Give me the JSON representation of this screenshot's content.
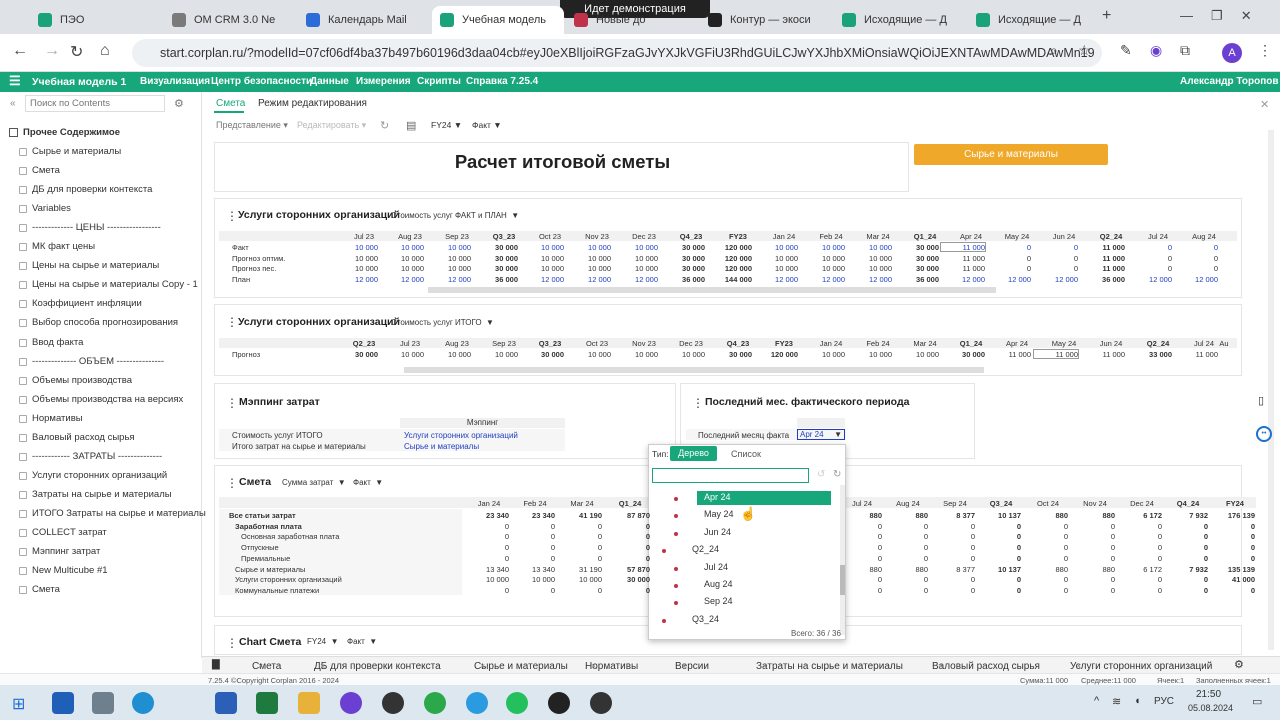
{
  "browser": {
    "tabs": [
      {
        "label": "ПЭО",
        "color": "#1aa37a"
      },
      {
        "label": "OM CRM 3.0 Ne",
        "color": "#7a7a7a"
      },
      {
        "label": "Календарь Mail",
        "color": "#2b6cd8"
      },
      {
        "label": "Учебная модель",
        "color": "#1aa37a"
      },
      {
        "label": "Новые до",
        "color": "#c0324a"
      },
      {
        "label": "Контур — экоси",
        "color": "#222222"
      },
      {
        "label": "Исходящие — Д",
        "color": "#1aa37a"
      },
      {
        "label": "Исходящие — Д",
        "color": "#1aa37a"
      }
    ],
    "demo_banner": "Идет демонстрация",
    "url": "start.corplan.ru/?modelId=07cf06df4ba37b497b60196d3daa04cb#eyJ0eXBlIjoiRGFzaGJvYXJkVGFiU3RhdGUiLCJwYXJhbXMiOnsiaWQiOiJEXNTAwMDAwMDAwMn19",
    "profile_initial": "A"
  },
  "app": {
    "title": "Учебная модель 1",
    "menu": [
      "Визуализация",
      "Центр безопасности",
      "Данные",
      "Измерения",
      "Скрипты",
      "Справка 7.25.4"
    ],
    "user": "Александр Торопов"
  },
  "sidebar": {
    "search_placeholder": "Поиск по Contents",
    "root": "Прочее Содержимое",
    "items": [
      "Сырье и материалы",
      "Смета",
      "ДБ для проверки контекста",
      "Variables",
      "------------- ЦЕНЫ -----------------",
      "МК факт цены",
      "Цены на сырье и материалы",
      "Цены на сырье и материалы Copy - 1",
      "Коэффициент инфляции",
      "Выбор способа прогнозирования",
      "Ввод факта",
      "-------------- ОБЪЕМ ---------------",
      "Объемы производства",
      "Объемы производства на версиях",
      "Нормативы",
      "Валовый расход сырья",
      "------------ ЗАТРАТЫ --------------",
      "Услуги сторонних организаций",
      "Затраты на сырье и материалы",
      "ИТОГО Затраты на сырье и материалы",
      "COLLECT затрат",
      "Мэппинг затрат",
      "New Multicube #1",
      "Смета"
    ]
  },
  "subtabs": [
    "Смета",
    "Режим редактирования"
  ],
  "toolbar": {
    "view": "Представление",
    "edit": "Редактировать",
    "period": "FY24",
    "version": "Факт"
  },
  "header": {
    "title": "Расчет итоговой сметы",
    "button": "Сырье и материалы"
  },
  "block1": {
    "title": "Услуги сторонних организаций",
    "selector": "Стоимость услуг ФАКТ и ПЛАН",
    "columns": [
      "Jul 23",
      "Aug 23",
      "Sep 23",
      "Q3_23",
      "Oct 23",
      "Nov 23",
      "Dec 23",
      "Q4_23",
      "FY23",
      "Jan 24",
      "Feb 24",
      "Mar 24",
      "Q1_24",
      "Apr 24",
      "May 24",
      "Jun 24",
      "Q2_24",
      "Jul 24",
      "Aug 24"
    ],
    "rows": [
      {
        "label": "Факт",
        "values": [
          "10 000",
          "10 000",
          "10 000",
          "30 000",
          "10 000",
          "10 000",
          "10 000",
          "30 000",
          "120 000",
          "10 000",
          "10 000",
          "10 000",
          "30 000",
          "11 000",
          "0",
          "0",
          "11 000",
          "0",
          "0"
        ]
      },
      {
        "label": "Прогноз оптим.",
        "values": [
          "10 000",
          "10 000",
          "10 000",
          "30 000",
          "10 000",
          "10 000",
          "10 000",
          "30 000",
          "120 000",
          "10 000",
          "10 000",
          "10 000",
          "30 000",
          "11 000",
          "0",
          "0",
          "11 000",
          "0",
          "0"
        ]
      },
      {
        "label": "Прогноз пес.",
        "values": [
          "10 000",
          "10 000",
          "10 000",
          "30 000",
          "10 000",
          "10 000",
          "10 000",
          "30 000",
          "120 000",
          "10 000",
          "10 000",
          "10 000",
          "30 000",
          "11 000",
          "0",
          "0",
          "11 000",
          "0",
          "0"
        ]
      },
      {
        "label": "План",
        "values": [
          "12 000",
          "12 000",
          "12 000",
          "36 000",
          "12 000",
          "12 000",
          "12 000",
          "36 000",
          "144 000",
          "12 000",
          "12 000",
          "12 000",
          "36 000",
          "12 000",
          "12 000",
          "12 000",
          "36 000",
          "12 000",
          "12 000"
        ]
      }
    ]
  },
  "block2": {
    "title": "Услуги сторонних организаций",
    "selector": "Стоимость услуг ИТОГО",
    "columns": [
      "Q2_23",
      "Jul 23",
      "Aug 23",
      "Sep 23",
      "Q3_23",
      "Oct 23",
      "Nov 23",
      "Dec 23",
      "Q4_23",
      "FY23",
      "Jan 24",
      "Feb 24",
      "Mar 24",
      "Q1_24",
      "Apr 24",
      "May 24",
      "Jun 24",
      "Q2_24",
      "Jul 24",
      "Au"
    ],
    "rows": [
      {
        "label": "Прогноз",
        "values": [
          "30 000",
          "10 000",
          "10 000",
          "10 000",
          "30 000",
          "10 000",
          "10 000",
          "10 000",
          "30 000",
          "120 000",
          "10 000",
          "10 000",
          "10 000",
          "30 000",
          "11 000",
          "11 000",
          "11 000",
          "33 000",
          "11 000",
          ""
        ]
      }
    ]
  },
  "block3": {
    "title": "Мэппинг затрат",
    "col_header": "Мэппинг",
    "rows": [
      {
        "label": "Стоимость услуг ИТОГО",
        "value": "Услуги сторонних организаций"
      },
      {
        "label": "Итого затрат на сырье и материалы",
        "value": "Сырье и материалы"
      }
    ]
  },
  "block4": {
    "title": "Последний мес. фактического периода",
    "label": "Последний месяц факта",
    "value": "Apr 24"
  },
  "block5": {
    "title": "Смета",
    "selector1": "Сумма затрат",
    "selector2": "Факт",
    "cols_left": [
      "Jan 24",
      "Feb 24",
      "Mar 24",
      "Q1_24"
    ],
    "cols_right": [
      "Jul 24",
      "Aug 24",
      "Sep 24",
      "Q3_24",
      "Oct 24",
      "Nov 24",
      "Dec 24",
      "Q4_24",
      "FY24"
    ],
    "rows": [
      {
        "label": "Все статьи затрат",
        "indent": 0,
        "bold": true,
        "left": [
          "23 340",
          "23 340",
          "41 190",
          "87 870"
        ],
        "right": [
          "880",
          "880",
          "8 377",
          "10 137",
          "880",
          "880",
          "6 172",
          "7 932",
          "176 139"
        ]
      },
      {
        "label": "Заработная плата",
        "indent": 1,
        "bold": true,
        "left": [
          "0",
          "0",
          "0",
          "0"
        ],
        "right": [
          "0",
          "0",
          "0",
          "0",
          "0",
          "0",
          "0",
          "0",
          "0"
        ]
      },
      {
        "label": "Основная заработная плата",
        "indent": 2,
        "bold": false,
        "left": [
          "0",
          "0",
          "0",
          "0"
        ],
        "right": [
          "0",
          "0",
          "0",
          "0",
          "0",
          "0",
          "0",
          "0",
          "0"
        ]
      },
      {
        "label": "Отпускные",
        "indent": 2,
        "bold": false,
        "left": [
          "0",
          "0",
          "0",
          "0"
        ],
        "right": [
          "0",
          "0",
          "0",
          "0",
          "0",
          "0",
          "0",
          "0",
          "0"
        ]
      },
      {
        "label": "Премиальные",
        "indent": 2,
        "bold": false,
        "left": [
          "0",
          "0",
          "0",
          "0"
        ],
        "right": [
          "0",
          "0",
          "0",
          "0",
          "0",
          "0",
          "0",
          "0",
          "0"
        ]
      },
      {
        "label": "Сырье и материалы",
        "indent": 1,
        "bold": false,
        "left": [
          "13 340",
          "13 340",
          "31 190",
          "57 870"
        ],
        "right": [
          "880",
          "880",
          "8 377",
          "10 137",
          "880",
          "880",
          "6 172",
          "7 932",
          "135 139"
        ]
      },
      {
        "label": "Услуги сторонних организаций",
        "indent": 1,
        "bold": false,
        "left": [
          "10 000",
          "10 000",
          "10 000",
          "30 000"
        ],
        "right": [
          "0",
          "0",
          "0",
          "0",
          "0",
          "0",
          "0",
          "0",
          "41 000"
        ]
      },
      {
        "label": "Коммунальные платежи",
        "indent": 1,
        "bold": false,
        "left": [
          "0",
          "0",
          "0",
          "0"
        ],
        "right": [
          "0",
          "0",
          "0",
          "0",
          "0",
          "0",
          "0",
          "0",
          "0"
        ]
      }
    ]
  },
  "block6": {
    "title": "Chart Смета",
    "selector1": "FY24",
    "selector2": "Факт"
  },
  "popup": {
    "type_label": "Тип:",
    "tab_tree": "Дерево",
    "tab_list": "Список",
    "items": [
      {
        "label": "Apr 24",
        "level": 2,
        "selected": true
      },
      {
        "label": "May 24",
        "level": 2
      },
      {
        "label": "Jun 24",
        "level": 2
      },
      {
        "label": "Q2_24",
        "level": 1
      },
      {
        "label": "Jul 24",
        "level": 2
      },
      {
        "label": "Aug 24",
        "level": 2
      },
      {
        "label": "Sep 24",
        "level": 2
      },
      {
        "label": "Q3_24",
        "level": 1
      }
    ],
    "footer": "Всего: 36 / 36"
  },
  "bottom_tabs": [
    "Смета",
    "ДБ для проверки контекста",
    "Сырье и материалы",
    "Нормативы",
    "Версии",
    "Затраты на сырье и материалы",
    "Валовый расход сырья",
    "Услуги сторонних организаций"
  ],
  "status": {
    "left": "7.25.4 ©Copyright Corplan 2016 - 2024",
    "sum": "Сумма:11 000",
    "avg": "Среднее:11 000",
    "cells": "Ячеек:1",
    "filled": "Заполненных ячеек:1"
  },
  "taskbar": {
    "lang": "РУС",
    "time": "21:50",
    "date": "05.08.2024"
  }
}
